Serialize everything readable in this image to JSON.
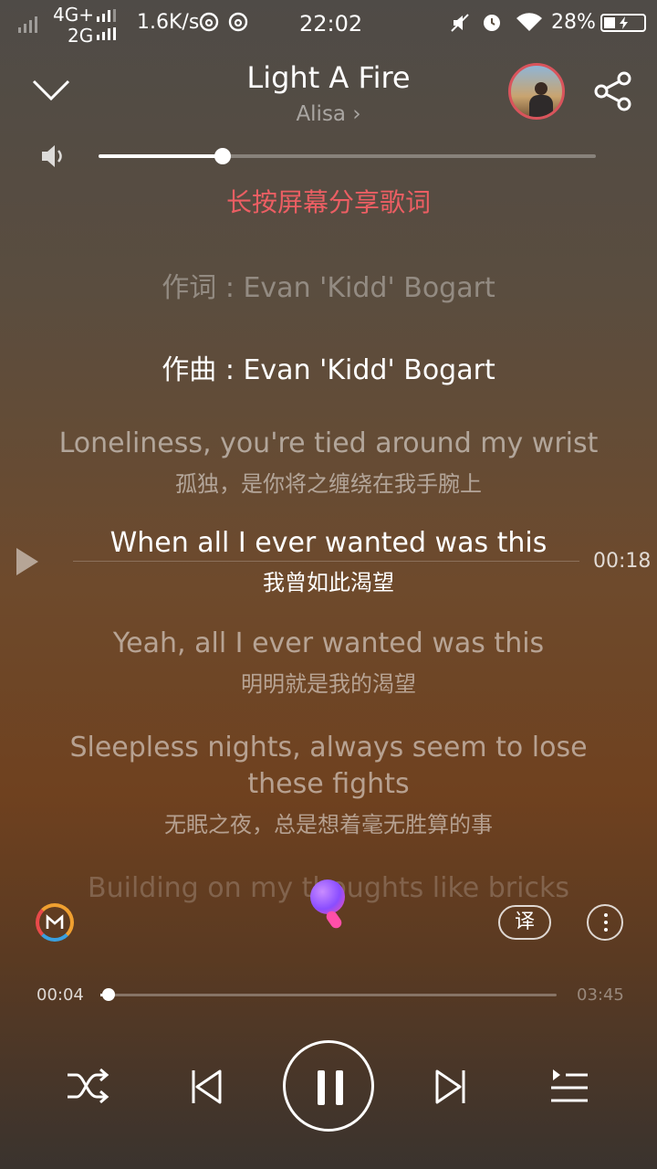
{
  "status": {
    "net1": "4G+",
    "net2": "2G",
    "speed": "1.6K/s",
    "time": "22:02",
    "battery": "28%"
  },
  "header": {
    "title": "Light A Fire",
    "artist": "Alisa",
    "artist_chevron": "›"
  },
  "volume": {
    "level": 0.25
  },
  "share_hint": "长按屏幕分享歌词",
  "lyrics": {
    "lyricist": "作词 : Evan 'Kidd' Bogart",
    "composer": "作曲 : Evan 'Kidd' Bogart",
    "lines": [
      {
        "en": "Loneliness, you're tied around my wrist",
        "zh": "孤独，是你将之缠绕在我手腕上"
      },
      {
        "en": "When all I ever wanted was this",
        "zh": "我曾如此渴望"
      },
      {
        "en": "Yeah, all I ever wanted was this",
        "zh": "明明就是我的渴望"
      },
      {
        "en": "Sleepless nights, always seem to lose",
        "en2": "these fights",
        "zh": "无眠之夜，总是想着毫无胜算的事"
      },
      {
        "en": "Building on my thoughts like bricks"
      }
    ],
    "current_time": "00:18"
  },
  "tools": {
    "translate": "译"
  },
  "progress": {
    "elapsed": "00:04",
    "total": "03:45",
    "fraction": 0.018
  }
}
